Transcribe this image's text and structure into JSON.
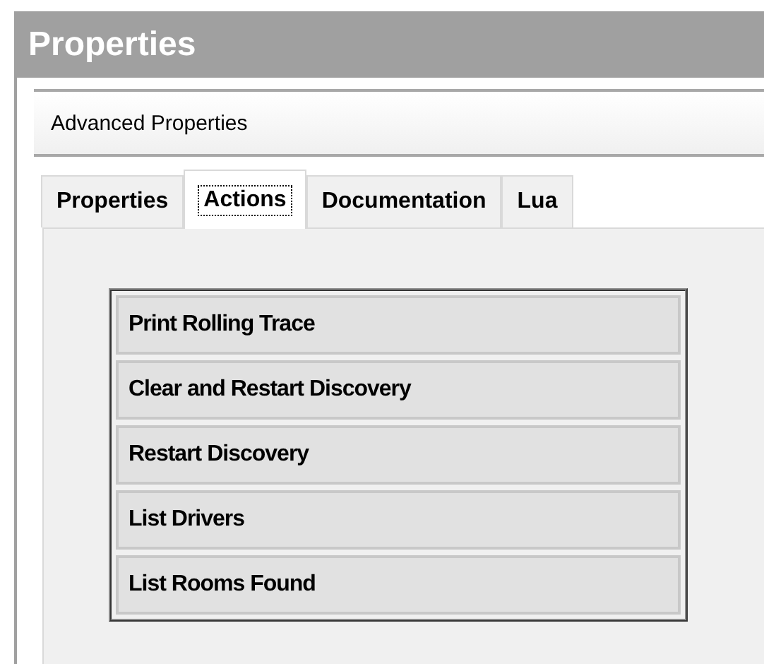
{
  "window": {
    "title": "Properties"
  },
  "section": {
    "title": "Advanced Properties"
  },
  "tabs": [
    {
      "label": "Properties",
      "selected": false
    },
    {
      "label": "Actions",
      "selected": true
    },
    {
      "label": "Documentation",
      "selected": false
    },
    {
      "label": "Lua",
      "selected": false
    }
  ],
  "actions": [
    "Print Rolling Trace",
    "Clear and Restart Discovery",
    "Restart Discovery",
    "List Drivers",
    "List Rooms Found"
  ]
}
